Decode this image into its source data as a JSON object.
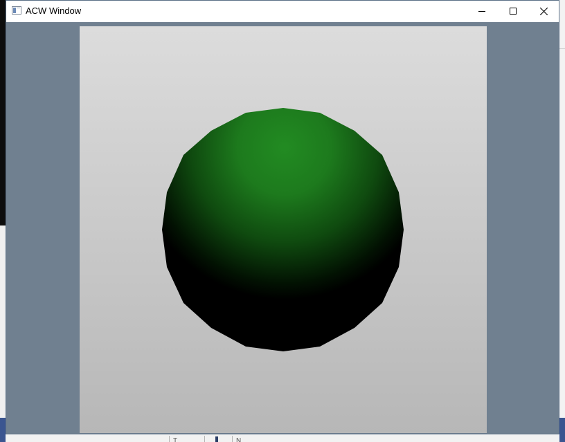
{
  "window": {
    "title": "ACW Window",
    "icon": "app-window-icon"
  },
  "controls": {
    "minimize_icon": "minimize-icon",
    "maximize_icon": "maximize-icon",
    "close_icon": "close-icon"
  },
  "scene": {
    "background_top_color": "#dcdcdc",
    "background_bottom_color": "#b7b7b7",
    "client_area_color": "#708090",
    "sphere_highlight_color": "#228b22",
    "sphere_shadow_color": "#000000"
  },
  "background": {
    "taskbar_text_1": "T",
    "taskbar_text_2": "N"
  }
}
